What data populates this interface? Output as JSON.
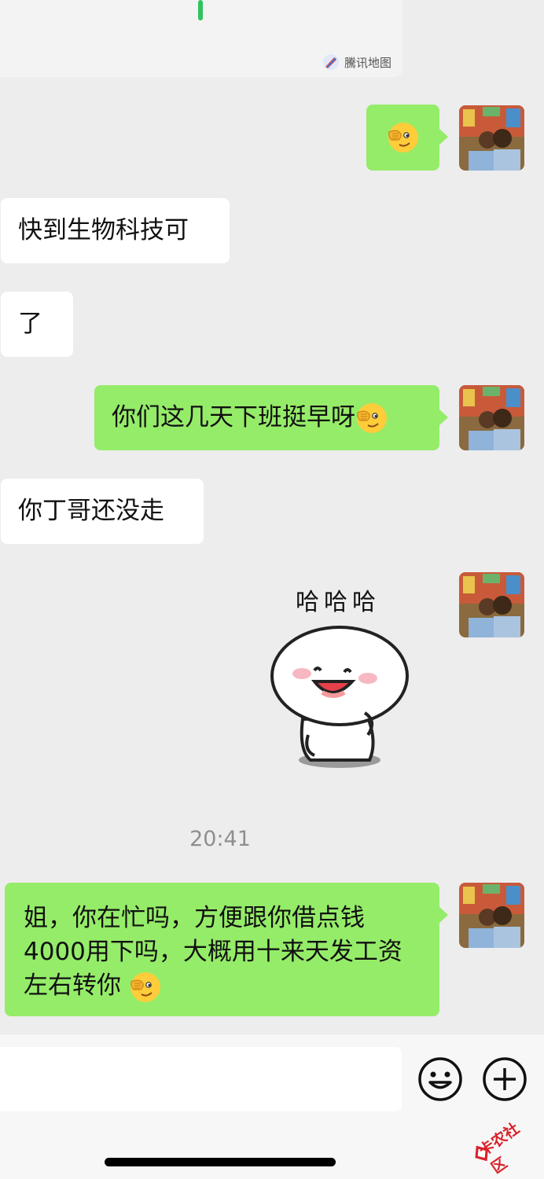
{
  "map": {
    "attribution": "騰讯地图"
  },
  "messages": [
    {
      "side": "out",
      "text": ""
    },
    {
      "side": "in",
      "text": "快到生物科技可"
    },
    {
      "side": "in",
      "text": "了"
    },
    {
      "side": "out",
      "text": "你们这几天下班挺早呀"
    },
    {
      "side": "in",
      "text": "你丁哥还没走"
    },
    {
      "side": "out",
      "sticker_text": "哈哈哈"
    },
    {
      "side": "out",
      "text": "姐，你在忙吗，方便跟你借点钱4000用下吗，大概用十来天发工资左右转你"
    }
  ],
  "time_divider": "20:41",
  "watermark": "卡农社区",
  "icons": {
    "emoji": "covering-eye-emoji",
    "map": "tencent-map-icon",
    "emoji_button": "smiley-face-icon",
    "plus_button": "plus-circle-icon"
  },
  "colors": {
    "out_bubble": "#95ec69",
    "in_bubble": "#ffffff",
    "background": "#ededed"
  }
}
